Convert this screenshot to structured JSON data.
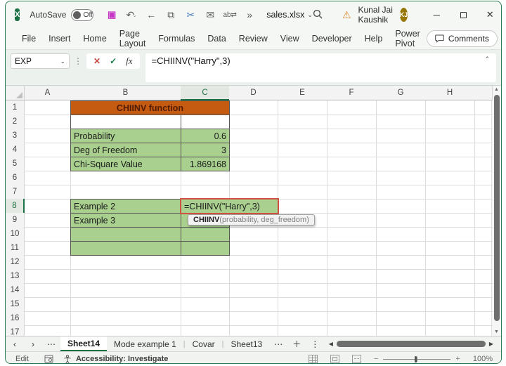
{
  "colors": {
    "accent_green": "#1E7145",
    "title_cell_bg": "#C55A11",
    "cell_green": "#A9D08E",
    "edit_border": "#CE5340",
    "save_icon": "#C437C4",
    "avatar_bg": "#977708"
  },
  "titlebar": {
    "app": "Excel",
    "autosave_label": "AutoSave",
    "autosave_state": "Off",
    "filename": "sales.xlsx",
    "user_name": "Kunal Jai Kaushik",
    "user_initials": "KJ",
    "qat_icons": [
      "save-icon",
      "undo-icon",
      "back-arrow-icon",
      "copy-icon",
      "cut-icon",
      "mail-icon",
      "replace-icon",
      "more-commands-icon"
    ]
  },
  "ribbon": {
    "tabs": [
      "File",
      "Insert",
      "Home",
      "Page Layout",
      "Formulas",
      "Data",
      "Review",
      "View",
      "Developer",
      "Help",
      "Power Pivot"
    ],
    "comments_label": "Comments"
  },
  "formula_bar": {
    "name_box": "EXP",
    "formula": "=CHIINV(\"Harry\",3)"
  },
  "sheet": {
    "columns": [
      "A",
      "B",
      "C",
      "D",
      "E",
      "F",
      "G",
      "H"
    ],
    "selected_column": "C",
    "rows": [
      "1",
      "2",
      "3",
      "4",
      "5",
      "6",
      "7",
      "8",
      "9",
      "10",
      "11",
      "12",
      "13",
      "14",
      "15",
      "16",
      "17"
    ],
    "selected_row": "8",
    "cells": [
      {
        "col": "B",
        "row": 1,
        "colspan": 2,
        "text": "CHIINV function",
        "style": "title"
      },
      {
        "col": "B",
        "row": 2,
        "text": "",
        "style": "plain"
      },
      {
        "col": "C",
        "row": 2,
        "text": "",
        "style": "plain"
      },
      {
        "col": "B",
        "row": 3,
        "text": "Probability",
        "style": "green"
      },
      {
        "col": "C",
        "row": 3,
        "text": "0.6",
        "style": "green",
        "align": "right"
      },
      {
        "col": "B",
        "row": 4,
        "text": "Deg of Freedom",
        "style": "green"
      },
      {
        "col": "C",
        "row": 4,
        "text": "3",
        "style": "green",
        "align": "right"
      },
      {
        "col": "B",
        "row": 5,
        "text": "Chi-Square Value",
        "style": "green"
      },
      {
        "col": "C",
        "row": 5,
        "text": "1.869168",
        "style": "green",
        "align": "right"
      },
      {
        "col": "B",
        "row": 8,
        "text": "Example 2",
        "style": "green"
      },
      {
        "col": "C",
        "row": 8,
        "colspan": 2,
        "text": "=CHIINV(\"Harry\",3)",
        "style": "green",
        "edit": true
      },
      {
        "col": "B",
        "row": 9,
        "text": "Example 3",
        "style": "green"
      },
      {
        "col": "C",
        "row": 9,
        "text": "",
        "style": "green"
      },
      {
        "col": "B",
        "row": 10,
        "text": "",
        "style": "green"
      },
      {
        "col": "C",
        "row": 10,
        "text": "",
        "style": "green"
      },
      {
        "col": "B",
        "row": 11,
        "text": "",
        "style": "green"
      },
      {
        "col": "C",
        "row": 11,
        "text": "",
        "style": "green"
      }
    ],
    "tooltip": {
      "bold": "CHIINV",
      "rest": "(probability, deg_freedom)"
    }
  },
  "sheet_tabs": {
    "active": "Sheet14",
    "others": [
      "Mode example 1",
      "Covar",
      "Sheet13"
    ]
  },
  "status_bar": {
    "mode": "Edit",
    "accessibility": "Accessibility: Investigate",
    "zoom": "100%"
  }
}
